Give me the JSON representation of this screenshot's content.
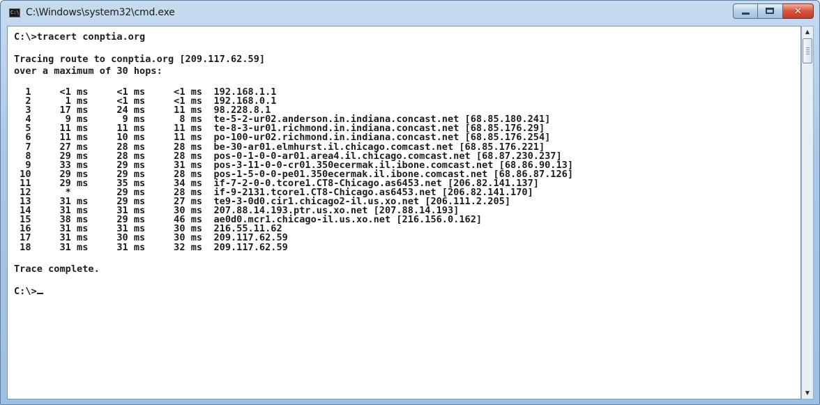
{
  "window": {
    "title": "C:\\Windows\\system32\\cmd.exe",
    "icon": "console-icon",
    "icon_text": "C:\\",
    "controls": {
      "minimize": "minimize-icon",
      "maximize": "maximize-icon",
      "close": "✕"
    }
  },
  "console": {
    "command_line": "C:\\>tracert conptia.org",
    "tracing_line_1": "Tracing route to conptia.org [209.117.62.59]",
    "tracing_line_2": "over a maximum of 30 hops:",
    "hops": [
      "  1     <1 ms     <1 ms     <1 ms  192.168.1.1",
      "  2      1 ms     <1 ms     <1 ms  192.168.0.1",
      "  3     17 ms     24 ms     11 ms  98.228.8.1",
      "  4      9 ms      9 ms      8 ms  te-5-2-ur02.anderson.in.indiana.concast.net [68.85.180.241]",
      "  5     11 ms     11 ms     11 ms  te-8-3-ur01.richmond.in.indiana.concast.net [68.85.176.29]",
      "  6     11 ms     10 ms     11 ms  po-100-ur02.richmond.in.indiana.concast.net [68.85.176.254]",
      "  7     27 ms     28 ms     28 ms  be-30-ar01.elmhurst.il.chicago.comcast.net [68.85.176.221]",
      "  8     29 ms     28 ms     28 ms  pos-0-1-0-0-ar01.area4.il.chicago.comcast.net [68.87.230.237]",
      "  9     33 ms     29 ms     31 ms  pos-3-11-0-0-cr01.350ecermak.il.ibone.comcast.net [68.86.90.13]",
      " 10     29 ms     29 ms     28 ms  pos-1-5-0-0-pe01.350ecermak.il.ibone.comcast.net [68.86.87.126]",
      " 11     29 ms     35 ms     34 ms  if-7-2-0-0.tcore1.CT8-Chicago.as6453.net [206.82.141.137]",
      " 12      *        29 ms     28 ms  if-9-2131.tcore1.CT8-Chicago.as6453.net [206.82.141.170]",
      " 13     31 ms     29 ms     27 ms  te9-3-0d0.cir1.chicago2-il.us.xo.net [206.111.2.205]",
      " 14     31 ms     31 ms     30 ms  207.88.14.193.ptr.us.xo.net [207.88.14.193]",
      " 15     38 ms     29 ms     46 ms  ae0d0.mcr1.chicago-il.us.xo.net [216.156.0.162]",
      " 16     31 ms     31 ms     30 ms  216.55.11.62",
      " 17     31 ms     30 ms     30 ms  209.117.62.59",
      " 18     31 ms     31 ms     32 ms  209.117.62.59"
    ],
    "trace_complete": "Trace complete.",
    "prompt": "C:\\>"
  }
}
